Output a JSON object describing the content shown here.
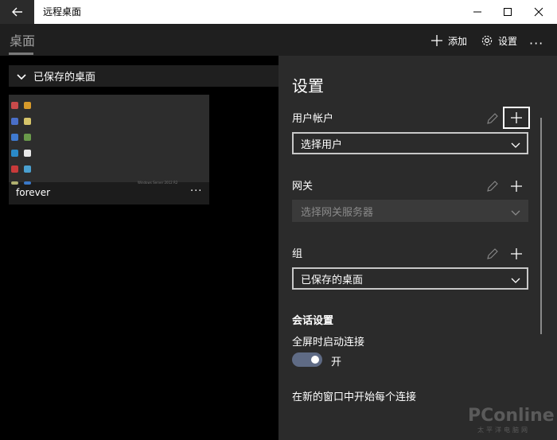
{
  "window": {
    "title": "远程桌面"
  },
  "header": {
    "tab_label": "桌面",
    "add_label": "添加",
    "settings_label": "设置",
    "more_label": "···"
  },
  "left": {
    "group_title": "已保存的桌面",
    "tiles": [
      {
        "name": "forever",
        "more": "···",
        "watermark": "Windows Server 2012 R2"
      }
    ]
  },
  "settings": {
    "title": "设置",
    "user_account": {
      "label": "用户帐户",
      "select_value": "选择用户"
    },
    "gateway": {
      "label": "网关",
      "select_value": "选择网关服务器"
    },
    "group": {
      "label": "组",
      "select_value": "已保存的桌面"
    },
    "session": {
      "heading": "会话设置",
      "fullscreen_label": "全屏时启动连接",
      "fullscreen_state": "开",
      "new_window_label": "在新的窗口中开始每个连接"
    },
    "brand": {
      "name": "PConline",
      "sub": "太平洋电脑网"
    }
  }
}
